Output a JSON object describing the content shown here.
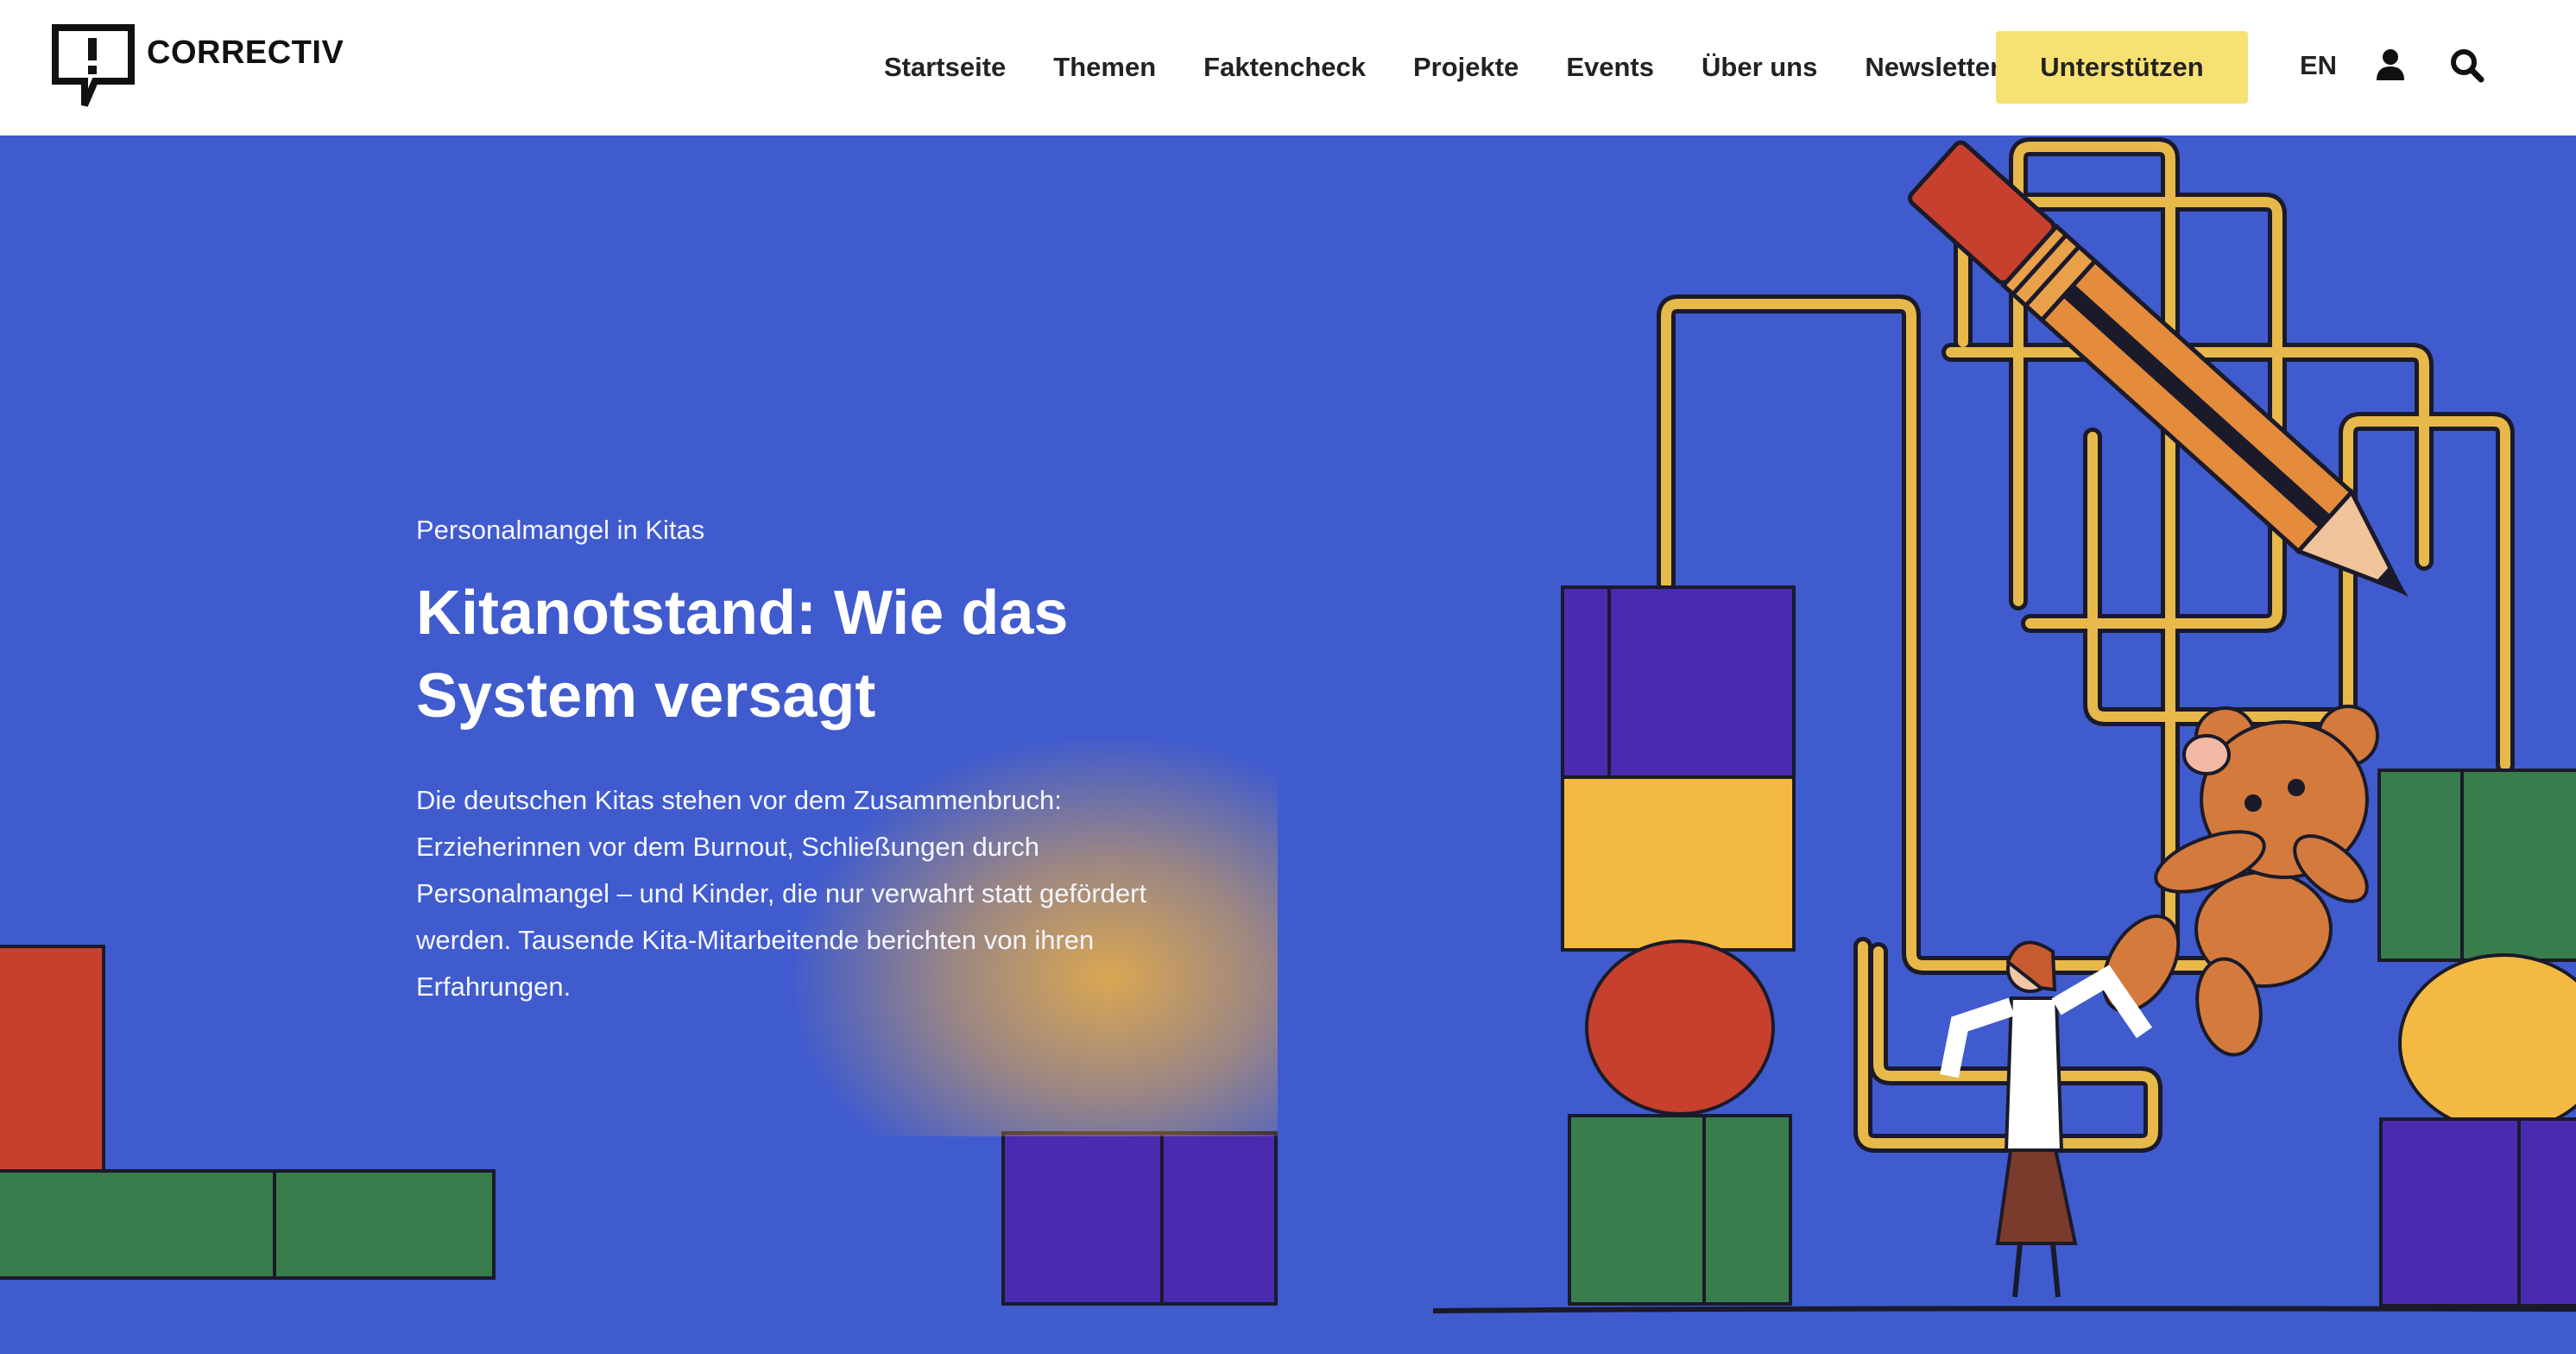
{
  "header": {
    "logo_text": "CORRECTIV",
    "nav": [
      {
        "label": "Startseite"
      },
      {
        "label": "Themen"
      },
      {
        "label": "Faktencheck"
      },
      {
        "label": "Projekte"
      },
      {
        "label": "Events"
      },
      {
        "label": "Über uns"
      },
      {
        "label": "Newsletter"
      }
    ],
    "support_label": "Unterstützen",
    "language": "EN",
    "icons": {
      "user": "user-icon",
      "search": "search-icon",
      "logo": "speech-bubble-exclamation-icon"
    }
  },
  "hero": {
    "kicker": "Personalmangel in Kitas",
    "headline": "Kitanotstand: Wie das System versagt",
    "teaser": "Die deutschen Kitas stehen vor dem Zusammenbruch: Erzieherinnen vor dem Burnout, Schließungen durch Personalmangel – und Kinder, die nur verwahrt statt gefördert werden. Tausende Kita-Mitarbeitende berichten von ihren Erfahrungen."
  },
  "colors": {
    "hero_background": "#405bce",
    "support_button": "#f7e173",
    "block_purple": "#4a2bb0",
    "block_yellow": "#f4b942",
    "block_red": "#c7402d",
    "block_green": "#3a7d4d",
    "tube_gold": "#e7b84a"
  }
}
